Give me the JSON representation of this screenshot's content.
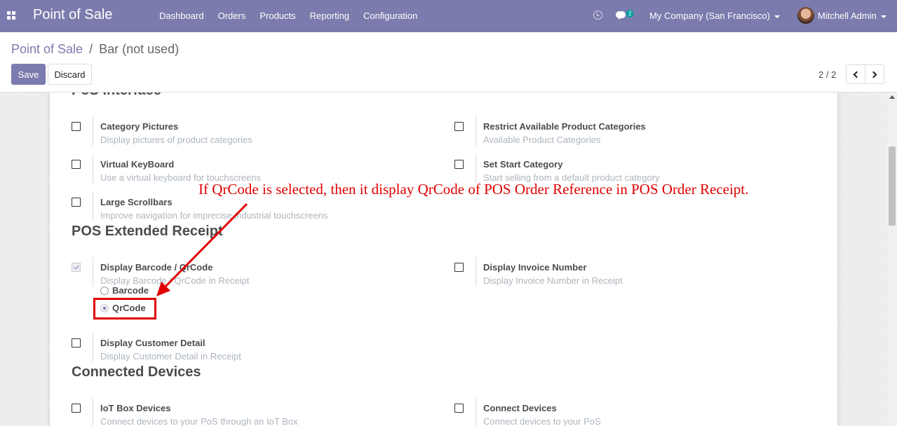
{
  "navbar": {
    "app_title": "Point of Sale",
    "menu": [
      "Dashboard",
      "Orders",
      "Products",
      "Reporting",
      "Configuration"
    ],
    "chat_count": "2",
    "company": "My Company (San Francisco)",
    "user": "Mitchell Admin",
    "color": "#7c7bad"
  },
  "breadcrumb": {
    "parent": "Point of Sale",
    "separator": "/",
    "current": "Bar (not used)"
  },
  "buttons": {
    "save": "Save",
    "discard": "Discard"
  },
  "pager": {
    "value": "2 / 2"
  },
  "sections": {
    "pos_interface": "PoS Interface",
    "extended_receipt": "POS Extended Receipt",
    "connected_devices": "Connected Devices"
  },
  "settings": {
    "category_pictures": {
      "label": "Category Pictures",
      "desc": "Display pictures of product categories",
      "checked": false
    },
    "restrict_categories": {
      "label": "Restrict Available Product Categories",
      "desc": "Available Product Categories",
      "checked": false
    },
    "virtual_keyboard": {
      "label": "Virtual KeyBoard",
      "desc": "Use a virtual keyboard for touchscreens",
      "checked": false
    },
    "start_category": {
      "label": "Set Start Category",
      "desc": "Start selling from a default product category",
      "checked": false
    },
    "large_scrollbars": {
      "label": "Large Scrollbars",
      "desc": "Improve navigation for imprecise industrial touchscreens",
      "checked": false
    },
    "display_barcode": {
      "label": "Display Barcode / QrCode",
      "desc": "Display Barcode / QrCode in Receipt",
      "checked": true
    },
    "invoice_number": {
      "label": "Display Invoice Number",
      "desc": "Display Invoice Number in Receipt",
      "checked": false
    },
    "customer_detail": {
      "label": "Display Customer Detail",
      "desc": "Display Customer Detail in Receipt",
      "checked": false
    },
    "iot_box": {
      "label": "IoT Box Devices",
      "desc": "Connect devices to your PoS through an IoT Box",
      "checked": false
    },
    "connect_devices": {
      "label": "Connect Devices",
      "desc": "Connect devices to your PoS",
      "checked": false
    }
  },
  "barcode_type": {
    "options": [
      "Barcode",
      "QrCode"
    ],
    "selected": "QrCode"
  },
  "annotation": {
    "text": "If QrCode is selected, then it display QrCode of POS Order Reference in POS Order Receipt.",
    "color": "#e00000"
  }
}
